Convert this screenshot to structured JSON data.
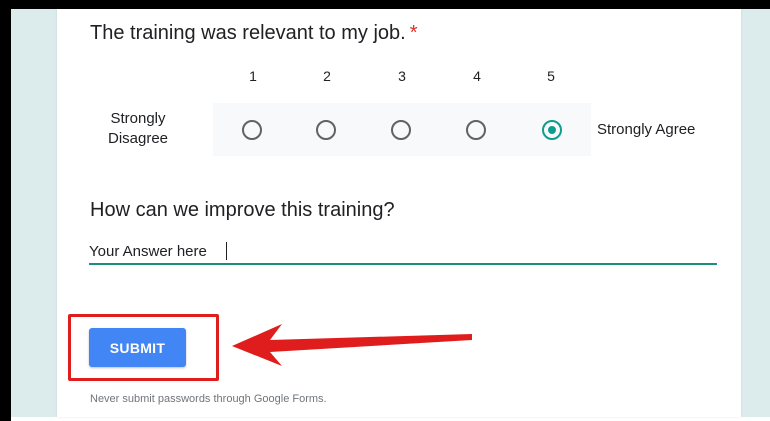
{
  "colors": {
    "accent": "#0f9d8e",
    "submit_button": "#4285f4",
    "required_star": "#d93025",
    "annotation_red": "#e01d1d",
    "page_background": "#dcecec"
  },
  "question1": {
    "title": "The training was relevant to my job.",
    "required_mark": "*",
    "scale_numbers": [
      "1",
      "2",
      "3",
      "4",
      "5"
    ],
    "low_label": "Strongly Disagree",
    "high_label": "Strongly Agree",
    "selected_value": 5
  },
  "question2": {
    "title": "How can we improve this training?",
    "answer_value": "Your Answer here"
  },
  "actions": {
    "submit_label": "SUBMIT"
  },
  "footer": {
    "note": "Never submit passwords through Google Forms."
  },
  "annotation": {
    "arrow_icon": "red-arrow-left-icon",
    "highlight": "red-rectangle-outline"
  }
}
